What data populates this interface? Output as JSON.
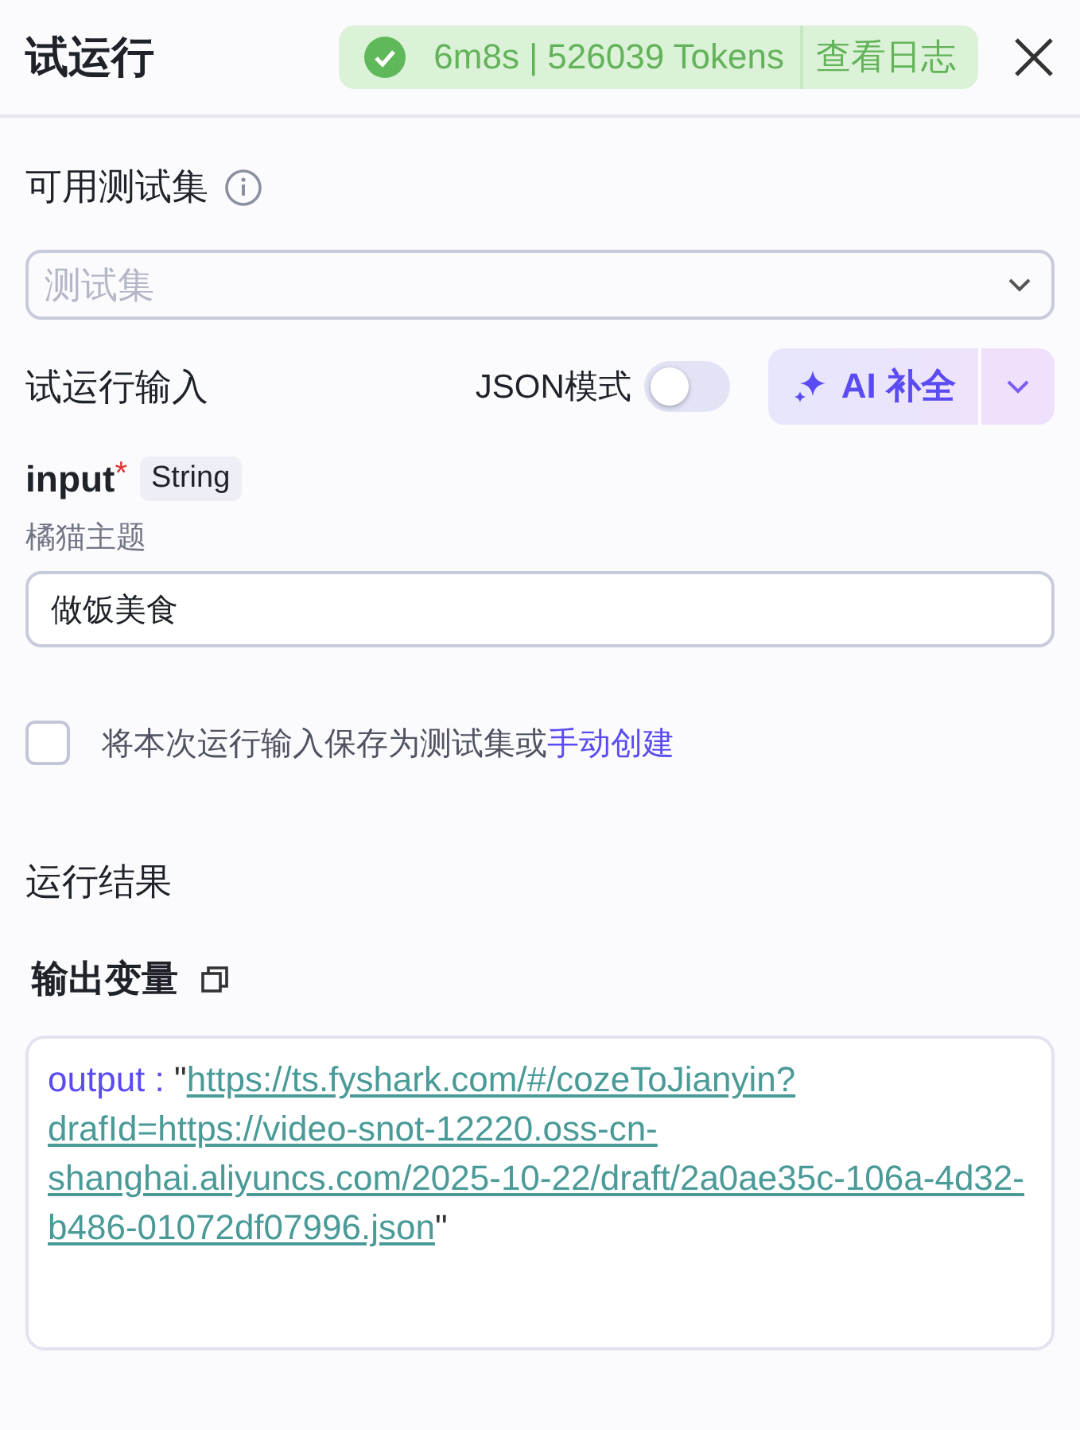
{
  "header": {
    "title": "试运行",
    "status": {
      "ok": true,
      "duration": "6m8s",
      "separator": "|",
      "tokens": "526039 Tokens",
      "log_link": "查看日志"
    }
  },
  "test_set": {
    "label": "可用测试集",
    "placeholder": "测试集"
  },
  "run_input": {
    "label": "试运行输入",
    "json_mode_label": "JSON模式",
    "json_mode_on": false,
    "ai_button": "AI 补全"
  },
  "fields": [
    {
      "name": "input",
      "required": true,
      "required_mark": "*",
      "type": "String",
      "description": "橘猫主题",
      "value": "做饭美食"
    }
  ],
  "save_option": {
    "checked": false,
    "text": "将本次运行输入保存为测试集或",
    "link": "手动创建"
  },
  "result": {
    "title": "运行结果",
    "output_title": "输出变量",
    "key": "output :",
    "quote_open": "\"",
    "url": "https://ts.fyshark.com/#/cozeToJianyin?drafId=https://video-snot-12220.oss-cn-shanghai.aliyuncs.com/2025-10-22/draft/2a0ae35c-106a-4d32-b486-01072df07996.json",
    "quote_close": "\""
  }
}
